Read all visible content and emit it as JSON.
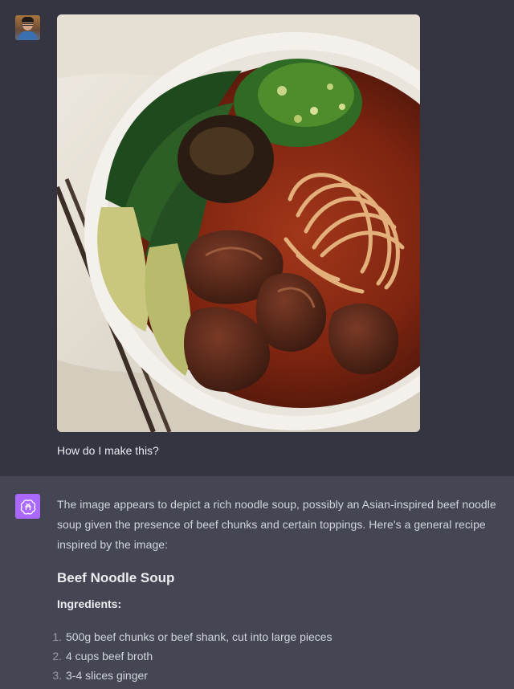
{
  "conversation": {
    "user_message": {
      "avatar_icon": "user-photo-avatar",
      "image_alt": "Bowl of beef noodle soup",
      "text": "How do I make this?"
    },
    "assistant_message": {
      "avatar_icon": "openai-logo-icon",
      "avatar_color": "#ab68ff",
      "intro": "The image appears to depict a rich noodle soup, possibly an Asian-inspired beef noodle soup given the presence of beef chunks and certain toppings. Here's a general recipe inspired by the image:",
      "recipe_title": "Beef Noodle Soup",
      "ingredients_heading": "Ingredients:",
      "ingredients": [
        {
          "num": "1.",
          "text": "500g beef chunks or beef shank, cut into large pieces"
        },
        {
          "num": "2.",
          "text": "4 cups beef broth"
        },
        {
          "num": "3.",
          "text": "3-4 slices ginger"
        }
      ]
    }
  },
  "colors": {
    "user_bg": "#343541",
    "assistant_bg": "#444654",
    "text": "#ececf1"
  }
}
